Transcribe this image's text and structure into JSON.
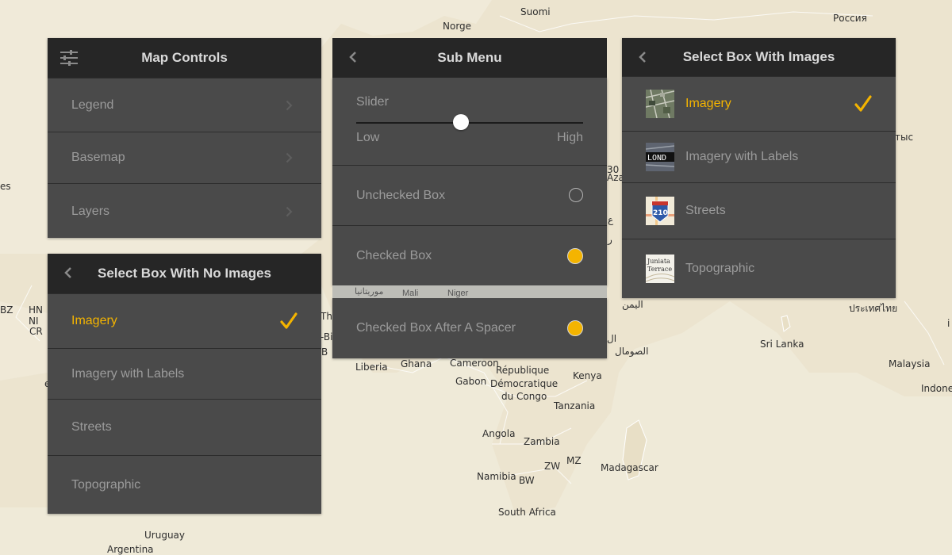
{
  "map": {
    "labels": {
      "suomi": "Suomi",
      "norge": "Norge",
      "rossiya": "Россия",
      "bz": "BZ",
      "hn": "HN",
      "ni": "NI",
      "cr": "CR",
      "es": "es",
      "b": "B",
      "the": "The",
      "bi": "-Bi",
      "e": "e",
      "liberia": "Liberia",
      "ghana": "Ghana",
      "cameroon": "Cameroon",
      "rep1": "République",
      "rep2": "Démocratique",
      "rep3": "du Congo",
      "gabon": "Gabon",
      "kenya": "Kenya",
      "tanzania": "Tanzania",
      "angola": "Angola",
      "zambia": "Zambia",
      "zw": "ZW",
      "mz": "MZ",
      "namibia": "Namibia",
      "bw": "BW",
      "madagascar": "Madagascar",
      "south_africa": "South Africa",
      "uruguay": "Uruguay",
      "argentina": "Argentina",
      "somalia": "الصومال",
      "yemen": "اليمن",
      "ethiopia_frag": "ال",
      "ar_frag1": "ع",
      "ar_frag2": "ر",
      "aza": "Aza",
      "num": "30",
      "thai": "ประเทศไทย",
      "sri_lanka": "Sri Lanka",
      "malaysia": "Malaysia",
      "indonesia": "Indone",
      "cyr_frag": "тыс",
      "i_frag": "i"
    },
    "spacer_labels": [
      "موريتانيا",
      "Mali",
      "Niger"
    ]
  },
  "map_controls": {
    "title": "Map Controls",
    "icon": "sliders-icon",
    "items": [
      {
        "label": "Legend"
      },
      {
        "label": "Basemap"
      },
      {
        "label": "Layers"
      }
    ]
  },
  "sub_menu": {
    "title": "Sub Menu",
    "slider": {
      "label": "Slider",
      "low": "Low",
      "high": "High",
      "value": 0.46
    },
    "items": [
      {
        "label": "Unchecked Box",
        "checked": false
      },
      {
        "label": "Checked Box",
        "checked": true
      },
      {
        "label": "Checked Box After A Spacer",
        "checked": true
      }
    ]
  },
  "select_no_images": {
    "title": "Select Box With No Images",
    "items": [
      {
        "label": "Imagery",
        "selected": true
      },
      {
        "label": "Imagery with Labels",
        "selected": false
      },
      {
        "label": "Streets",
        "selected": false
      },
      {
        "label": "Topographic",
        "selected": false
      }
    ]
  },
  "select_images": {
    "title": "Select Box With Images",
    "items": [
      {
        "label": "Imagery",
        "selected": true,
        "thumb": "imagery-thumbnail"
      },
      {
        "label": "Imagery with Labels",
        "selected": false,
        "thumb": "imagery-labels-thumbnail",
        "thumb_text": "LOND"
      },
      {
        "label": "Streets",
        "selected": false,
        "thumb": "streets-thumbnail",
        "thumb_text": "210"
      },
      {
        "label": "Topographic",
        "selected": false,
        "thumb": "topographic-thumbnail",
        "thumb_text": "Juniata",
        "thumb_text2": "Terrace"
      }
    ]
  },
  "colors": {
    "accent": "#f4b400",
    "panel": "#4a4a4a",
    "header": "#262626",
    "map_land": "#ece4cf",
    "map_water": "#f5f0e3"
  }
}
